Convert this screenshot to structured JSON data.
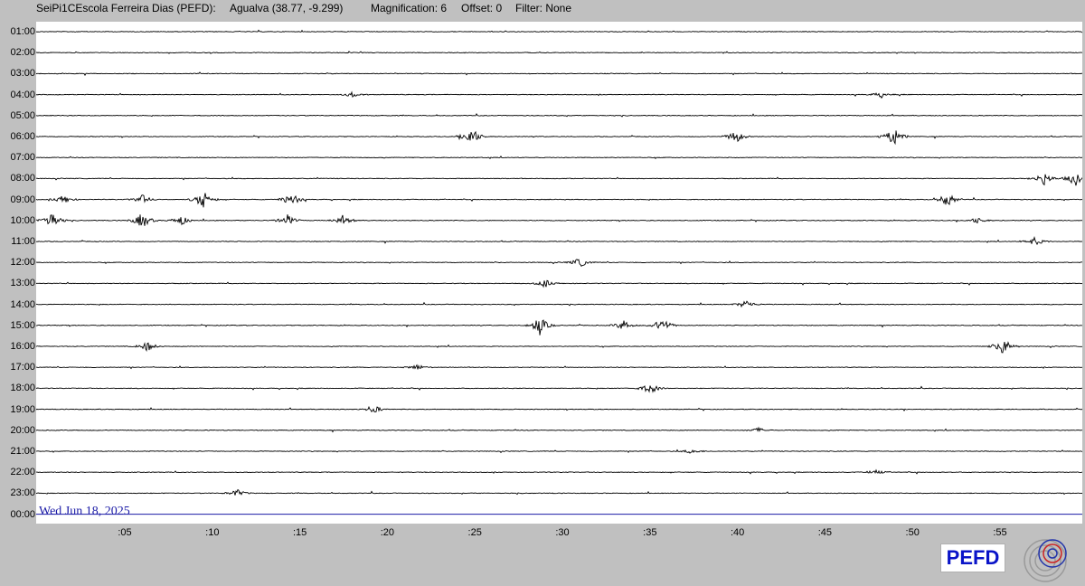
{
  "header": {
    "station": "SeiPi1CEscola Ferreira Dias (PEFD):",
    "location": "Agualva (38.77, -9.299)",
    "magnification": "Magnification: 6",
    "offset": "Offset: 0",
    "filter": "Filter: None"
  },
  "helicorder": {
    "row_labels": [
      "01:00",
      "02:00",
      "03:00",
      "04:00",
      "05:00",
      "06:00",
      "07:00",
      "08:00",
      "09:00",
      "10:00",
      "11:00",
      "12:00",
      "13:00",
      "14:00",
      "15:00",
      "16:00",
      "17:00",
      "18:00",
      "19:00",
      "20:00",
      "21:00",
      "22:00",
      "23:00",
      "00:00"
    ],
    "minute_labels": [
      ":05",
      ":10",
      ":15",
      ":20",
      ":25",
      ":30",
      ":35",
      ":40",
      ":45",
      ":50",
      ":55"
    ],
    "date_label": "Wed Jun 18, 2025",
    "trace_color": "#000000",
    "current_line_color": "#1a1aa6",
    "events": [
      {
        "row": 3,
        "minute": 18.0,
        "amp": 0.25
      },
      {
        "row": 3,
        "minute": 48.2,
        "amp": 0.3
      },
      {
        "row": 5,
        "minute": 24.8,
        "amp": 1.0
      },
      {
        "row": 5,
        "minute": 39.9,
        "amp": 0.7
      },
      {
        "row": 5,
        "minute": 48.9,
        "amp": 1.0
      },
      {
        "row": 7,
        "minute": 57.5,
        "amp": 0.7
      },
      {
        "row": 7,
        "minute": 59.3,
        "amp": 0.8
      },
      {
        "row": 8,
        "minute": 1.5,
        "amp": 0.45
      },
      {
        "row": 8,
        "minute": 6.0,
        "amp": 0.5
      },
      {
        "row": 8,
        "minute": 9.5,
        "amp": 1.0
      },
      {
        "row": 8,
        "minute": 14.5,
        "amp": 0.8
      },
      {
        "row": 8,
        "minute": 52.0,
        "amp": 0.7
      },
      {
        "row": 9,
        "minute": 0.8,
        "amp": 1.0
      },
      {
        "row": 9,
        "minute": 6.0,
        "amp": 0.85
      },
      {
        "row": 9,
        "minute": 8.2,
        "amp": 0.55
      },
      {
        "row": 9,
        "minute": 14.3,
        "amp": 0.6
      },
      {
        "row": 9,
        "minute": 17.5,
        "amp": 0.5
      },
      {
        "row": 9,
        "minute": 53.7,
        "amp": 0.3
      },
      {
        "row": 10,
        "minute": 57.0,
        "amp": 0.45
      },
      {
        "row": 11,
        "minute": 31.0,
        "amp": 0.5
      },
      {
        "row": 12,
        "minute": 29.0,
        "amp": 0.4
      },
      {
        "row": 13,
        "minute": 40.5,
        "amp": 0.45
      },
      {
        "row": 14,
        "minute": 28.7,
        "amp": 1.0
      },
      {
        "row": 14,
        "minute": 33.5,
        "amp": 0.55
      },
      {
        "row": 14,
        "minute": 35.7,
        "amp": 0.8
      },
      {
        "row": 15,
        "minute": 6.3,
        "amp": 0.5
      },
      {
        "row": 15,
        "minute": 55.2,
        "amp": 0.9
      },
      {
        "row": 16,
        "minute": 21.7,
        "amp": 0.3
      },
      {
        "row": 17,
        "minute": 35.0,
        "amp": 0.6
      },
      {
        "row": 18,
        "minute": 19.2,
        "amp": 0.45
      },
      {
        "row": 19,
        "minute": 41.2,
        "amp": 0.25
      },
      {
        "row": 20,
        "minute": 37.4,
        "amp": 0.25
      },
      {
        "row": 21,
        "minute": 47.9,
        "amp": 0.25
      },
      {
        "row": 22,
        "minute": 11.4,
        "amp": 0.4
      }
    ]
  },
  "logo": {
    "text": "PEFD"
  }
}
